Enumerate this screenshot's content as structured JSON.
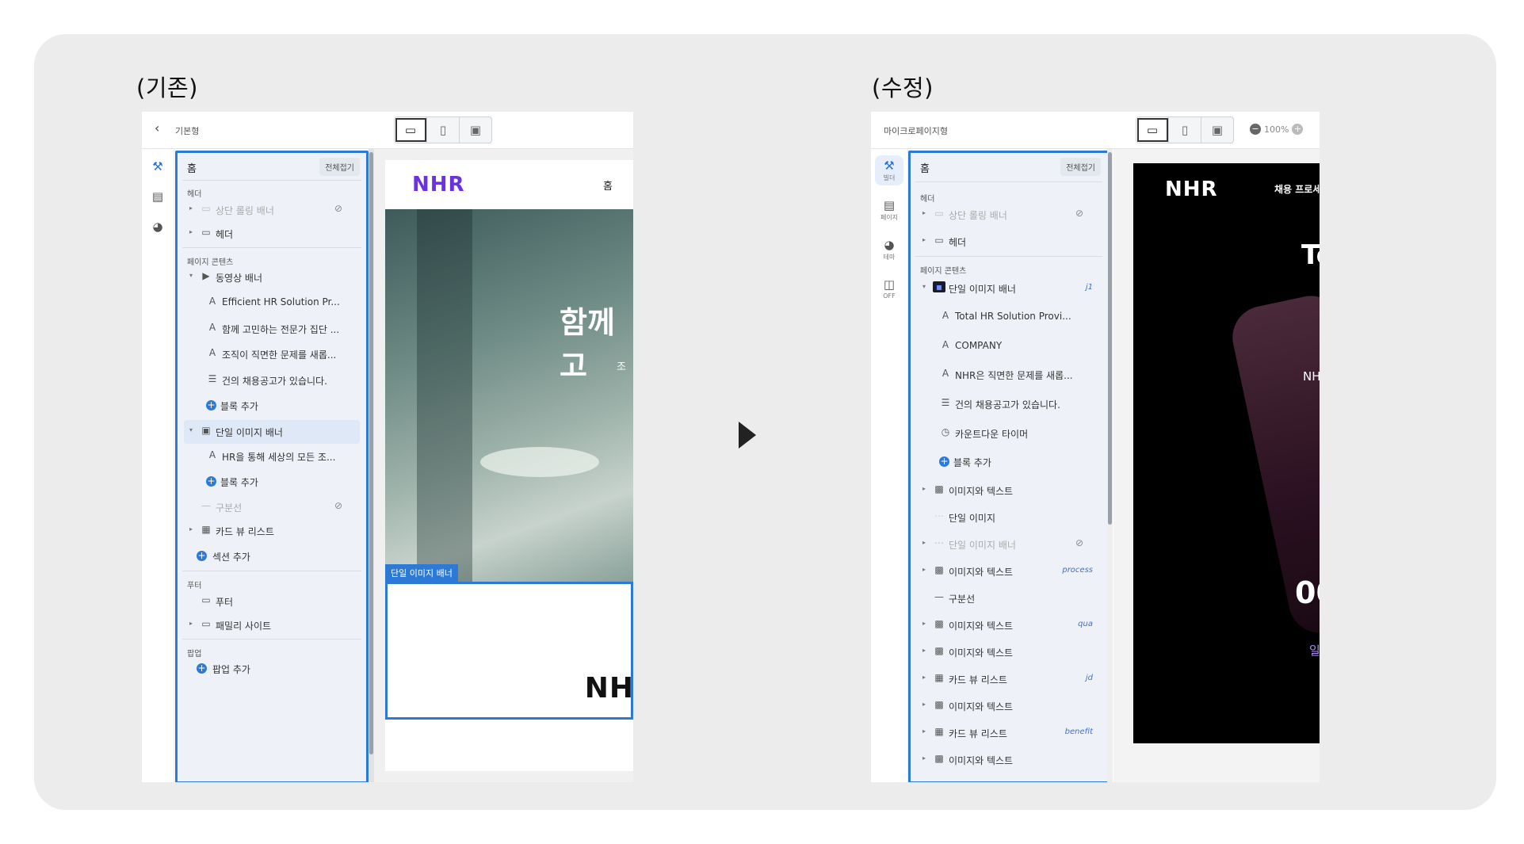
{
  "captions": {
    "before": "(기존)",
    "after": "(수정)"
  },
  "before": {
    "crumb": "기본형",
    "panel": {
      "title": "홈",
      "collapse_all": "전체접기",
      "header_section": "헤더",
      "rows": [
        {
          "label": "상단 롤링 배너"
        },
        {
          "label": "헤더"
        }
      ],
      "content_section": "페이지 콘텐츠",
      "content_rows": [
        {
          "label": "동영상 배너"
        },
        {
          "label": "Efficient HR Solution Pr..."
        },
        {
          "label": "함께 고민하는 전문가 집단 ..."
        },
        {
          "label": "조직이 직면한 문제를 새롭..."
        },
        {
          "label": "건의 채용공고가 있습니다."
        },
        {
          "label": "블록 추가"
        },
        {
          "label": "단일 이미지 배너"
        },
        {
          "label": "HR을 통해 세상의 모든 조..."
        },
        {
          "label": "블록 추가"
        },
        {
          "label": "구분선"
        },
        {
          "label": "카드 뷰 리스트"
        },
        {
          "label": "섹션 추가"
        }
      ],
      "footer_section": "푸터",
      "footer_rows": [
        {
          "label": "푸터"
        },
        {
          "label": "패밀리 사이트"
        }
      ],
      "popup_section": "팝업",
      "popup_rows": [
        {
          "label": "팝업 추가"
        }
      ]
    },
    "preview": {
      "logo": "NHR",
      "nav": "홈",
      "hero_title": "함께 고",
      "hero_sub": "조",
      "badge": "단일 이미지 배너",
      "bottom_logo": "NH"
    }
  },
  "after": {
    "crumb": "마이크로페이지형",
    "zoom": "100%",
    "rail": [
      {
        "icon": "wrench-icon",
        "label": "빌더"
      },
      {
        "icon": "book-icon",
        "label": "페이지"
      },
      {
        "icon": "palette-icon",
        "label": "테마"
      },
      {
        "icon": "door-icon",
        "label": "OFF"
      }
    ],
    "panel": {
      "title": "홈",
      "collapse_all": "전체접기",
      "header_section": "헤더",
      "rows": [
        {
          "label": "상단 롤링 배너"
        },
        {
          "label": "헤더"
        }
      ],
      "content_section": "페이지 콘텐츠",
      "content_rows": [
        {
          "label": "단일 이미지 배너",
          "tag": "j1"
        },
        {
          "label": "Total HR Solution Provi..."
        },
        {
          "label": "COMPANY"
        },
        {
          "label": "NHR은 직면한 문제를 새롭..."
        },
        {
          "label": "건의 채용공고가 있습니다."
        },
        {
          "label": "카운트다운 타이머"
        },
        {
          "label": "블록 추가"
        },
        {
          "label": "이미지와 텍스트"
        },
        {
          "label": "단일 이미지"
        },
        {
          "label": "단일 이미지 배너"
        },
        {
          "label": "이미지와 텍스트",
          "tag": "process"
        },
        {
          "label": "구분선"
        },
        {
          "label": "이미지와 텍스트",
          "tag": "qua"
        },
        {
          "label": "이미지와 텍스트"
        },
        {
          "label": "카드 뷰 리스트",
          "tag": "jd"
        },
        {
          "label": "이미지와 텍스트"
        },
        {
          "label": "카드 뷰 리스트",
          "tag": "benefit"
        },
        {
          "label": "이미지와 텍스트"
        }
      ]
    },
    "preview": {
      "logo": "NHR",
      "nav": "채용 프로세",
      "t1": "To",
      "t2": "NH",
      "t3": "00",
      "t4": "일"
    }
  }
}
